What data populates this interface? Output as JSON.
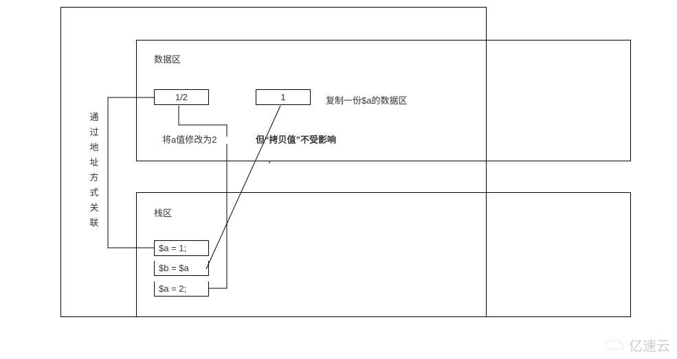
{
  "outer": "",
  "vertical_caption": "通过地址方式关联",
  "data_area": {
    "title": "数据区",
    "box_left": "1/2",
    "box_right": "1",
    "copy_note": "复制一份$a的数据区",
    "modify_note": "将a值修改为2",
    "copy_emphasis": "但“拷贝值”不受影响"
  },
  "stack_area": {
    "title": "栈区",
    "row1": "$a  = 1;",
    "row2": "$b  = $a",
    "row3": "$a  = 2;"
  },
  "watermark": "亿速云"
}
